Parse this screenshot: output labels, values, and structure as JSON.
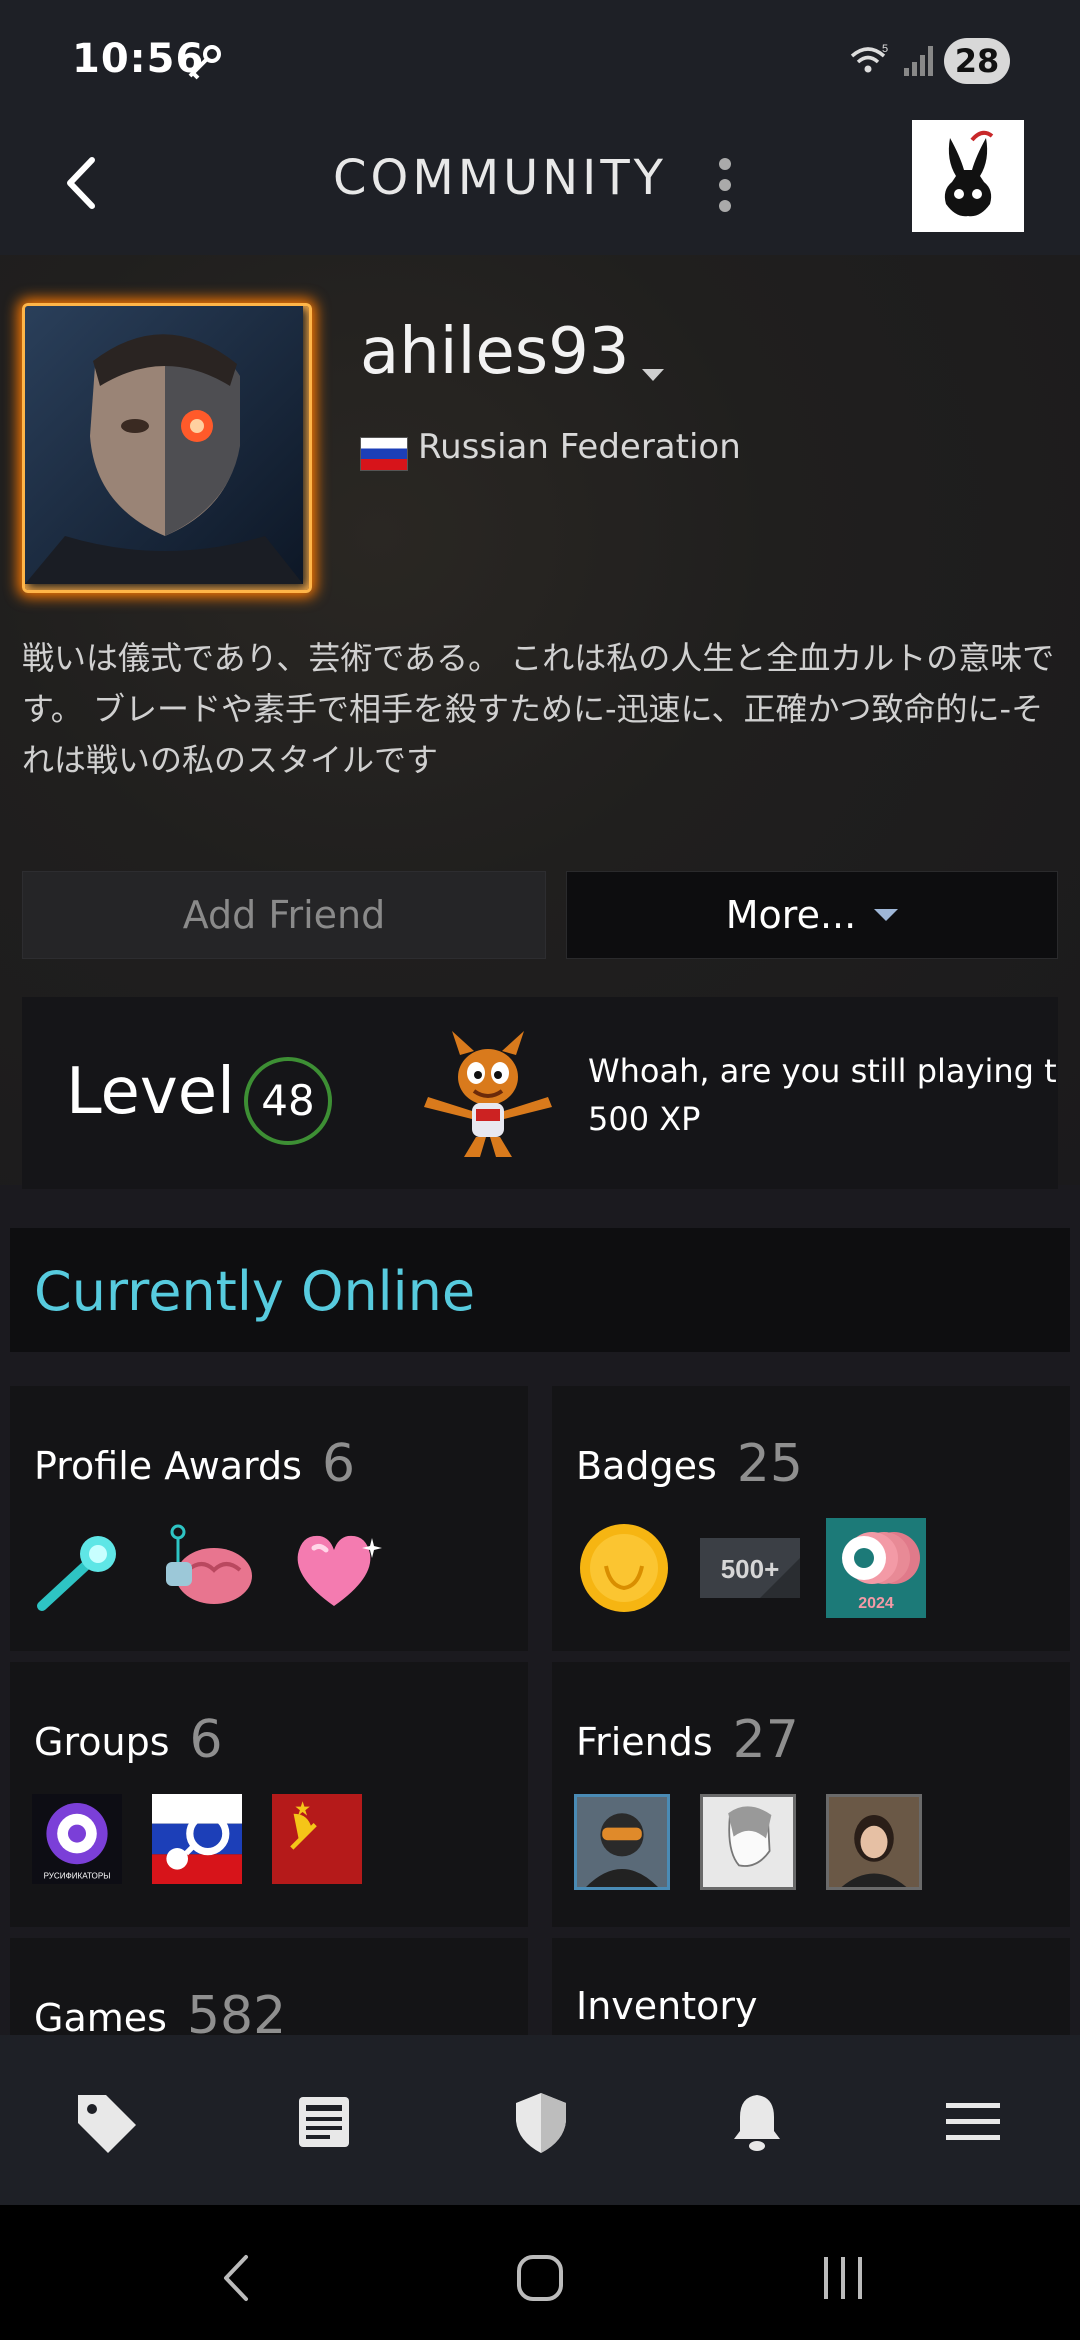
{
  "status_bar": {
    "time": "10:56",
    "wifi_superscript": "5",
    "battery": "28"
  },
  "topbar": {
    "title": "COMMUNITY"
  },
  "profile": {
    "username": "ahiles93",
    "country": "Russian Federation",
    "bio": "戦いは儀式であり、芸術である。 これは私の人生と全血カルトの意味です。 ブレードや素手で相手を殺すために-迅速に、正確かつ致命的に-それは戦いの私のスタイルです",
    "add_friend_label": "Add Friend",
    "more_label": "More..."
  },
  "level": {
    "label": "Level",
    "value": "48",
    "badge_text": "Whoah, are you still playing this",
    "badge_xp": "500 XP"
  },
  "status": {
    "online_text": "Currently Online"
  },
  "sections": {
    "profile_awards": {
      "label": "Profile Awards",
      "count": "6"
    },
    "badges": {
      "label": "Badges",
      "count": "25",
      "badge_500_text": "500+",
      "badge_year": "2024"
    },
    "groups": {
      "label": "Groups",
      "count": "6",
      "group1_caption": "РУСИФИКАТОРЫ"
    },
    "friends": {
      "label": "Friends",
      "count": "27"
    },
    "games": {
      "label": "Games",
      "count": "582"
    },
    "inventory": {
      "label": "Inventory"
    }
  },
  "colors": {
    "online": "#57cbde",
    "level_ring": "#3d8f34",
    "bar_bg": "#1e2026"
  },
  "icons": [
    "key-icon",
    "wifi-icon",
    "signal-icon",
    "back-arrow-icon",
    "kebab-menu-icon",
    "caret-down-icon",
    "tag-icon",
    "news-icon",
    "shield-icon",
    "bell-icon",
    "hamburger-icon",
    "system-back-icon",
    "system-home-icon",
    "system-recents-icon"
  ]
}
